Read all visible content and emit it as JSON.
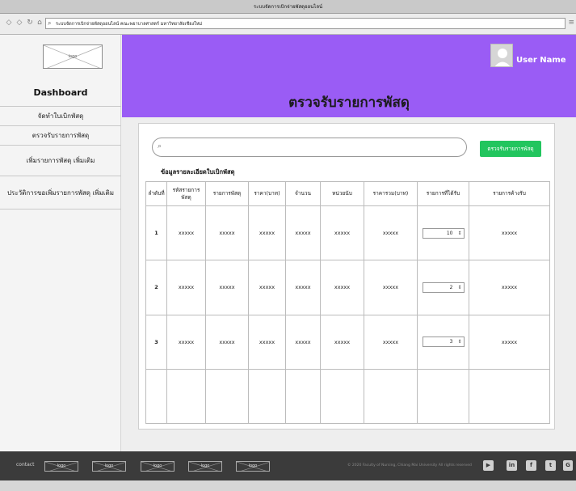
{
  "window": {
    "title": "ระบบจัดการเบิกจ่ายพัสดุออนไลน์"
  },
  "addressbar": {
    "url": "ระบบจัดการเบิกจ่ายพัสดุออนไลน์ คณะพยาบาลศาสตร์ มหาวิทยาลัยเชียงใหม่"
  },
  "sidebar": {
    "logo": "logo",
    "title": "Dashboard",
    "items": [
      {
        "label": "จัดทำใบเบิกพัสดุ"
      },
      {
        "label": "ตรวจรับรายการพัสดุ"
      },
      {
        "label": "เพิ่มรายการพัสดุ เพิ่มเติม"
      },
      {
        "label": "ประวัติการขอเพิ่มรายการพัสดุ เพิ่มเติม"
      }
    ]
  },
  "header": {
    "user_name": "User Name",
    "page_title": "ตรวจรับรายการพัสดุ"
  },
  "search": {
    "placeholder": "",
    "button_label": "ตรวจรับรายการพัสดุ"
  },
  "section": {
    "title": "ข้อมูลรายละเอียดใบเบิกพัสดุ"
  },
  "table": {
    "columns": [
      "ลำดับที่",
      "รหัสรายการพัสดุ",
      "รายการพัสดุ",
      "ราคา(บาท)",
      "จำนวน",
      "หน่วยนับ",
      "ราคารวม(บาท)",
      "รายการที่ได้รับ",
      "รายการค้างรับ"
    ],
    "rows": [
      {
        "no": "1",
        "code": "xxxxx",
        "item": "xxxxx",
        "price": "xxxxx",
        "qty": "xxxxx",
        "unit": "xxxxx",
        "total": "xxxxx",
        "received": "10",
        "pending": "xxxxx"
      },
      {
        "no": "2",
        "code": "xxxxx",
        "item": "xxxxx",
        "price": "xxxxx",
        "qty": "xxxxx",
        "unit": "xxxxx",
        "total": "xxxxx",
        "received": "2",
        "pending": "xxxxx"
      },
      {
        "no": "3",
        "code": "xxxxx",
        "item": "xxxxx",
        "price": "xxxxx",
        "qty": "xxxxx",
        "unit": "xxxxx",
        "total": "xxxxx",
        "received": "3",
        "pending": "xxxxx"
      }
    ]
  },
  "footer": {
    "contact": "contact",
    "logos": [
      "logo",
      "logo",
      "logo",
      "logo",
      "logo"
    ],
    "copyright": "© 2020 Faculty of Nursing, Chiang Mai University All rights reserved",
    "social_icons": [
      "youtube-icon",
      "linkedin-icon",
      "facebook-icon",
      "twitter-icon",
      "google-plus-icon"
    ]
  },
  "colors": {
    "banner": "#9a5cf5",
    "button": "#22c55e",
    "footer": "#3b3b3b"
  }
}
